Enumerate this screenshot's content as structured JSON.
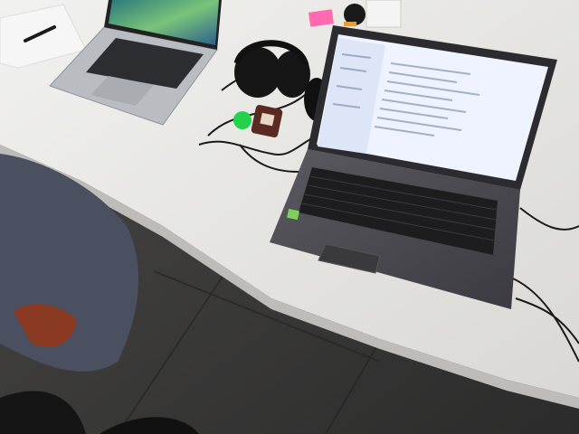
{
  "scene": {
    "description_hidden": "",
    "objects": [
      {
        "id": "desk",
        "icon": "desk"
      },
      {
        "id": "macbook-laptop",
        "icon": "laptop"
      },
      {
        "id": "acer-laptop",
        "icon": "laptop"
      },
      {
        "id": "headphones",
        "icon": "headphones"
      },
      {
        "id": "circuit-board",
        "icon": "microcontroller"
      },
      {
        "id": "sticky-note",
        "icon": "note"
      },
      {
        "id": "chair-jacket",
        "icon": "jacket"
      },
      {
        "id": "paper-sheet",
        "icon": "paper"
      }
    ]
  },
  "colors": {
    "desk": "#e4e3e0",
    "floor": "#3b3a3a",
    "laptop_silver": "#b9bdc2",
    "laptop_dark": "#3a3a3e",
    "screen_glow": "#eef3ff",
    "sticky": "#ff6ab0",
    "green": "#22d24a",
    "jacket": "#4a5060"
  }
}
